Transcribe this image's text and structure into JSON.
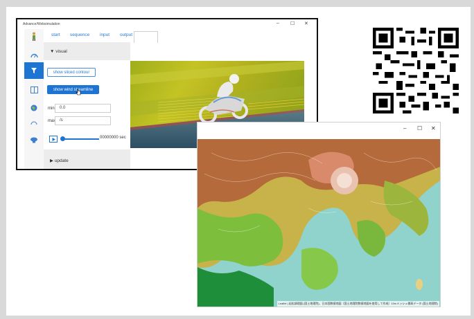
{
  "app": {
    "title": "Advance/Websimulation",
    "window_controls": {
      "minimize": "–",
      "maximize": "☐",
      "close": "✕"
    },
    "tabs": [
      {
        "label": "start"
      },
      {
        "label": "sequence"
      },
      {
        "label": "input"
      },
      {
        "label": "output",
        "active": true
      }
    ],
    "sidebar_icons": [
      "person-icon",
      "gauge-icon",
      "filter-icon",
      "book-icon",
      "globe-icon",
      "cloud-icon",
      "blimp-icon"
    ],
    "visual_section": {
      "header": "▼ visual",
      "sliced_contour_button": "show sliced contour",
      "wind_streamline_button": "show wind streamline",
      "min_label": "min",
      "min_value": "0.0",
      "max_label": "max",
      "max_value": "/s"
    },
    "playback": {
      "time": "00000000 sec",
      "progress": 0.0
    },
    "update_section": {
      "header": "▶ update"
    }
  },
  "map_window": {
    "window_controls": {
      "minimize": "–",
      "maximize": "☐",
      "close": "✕"
    },
    "attribution": "Leaflet | 岩松調理図 (国土地理院)、日本国数値地図（国土地理院数値地図を使用して作成）10mメッシュ標高データ (国土地理院)"
  },
  "colors": {
    "accent": "#1e74d3",
    "background": "#d9d9d9"
  }
}
